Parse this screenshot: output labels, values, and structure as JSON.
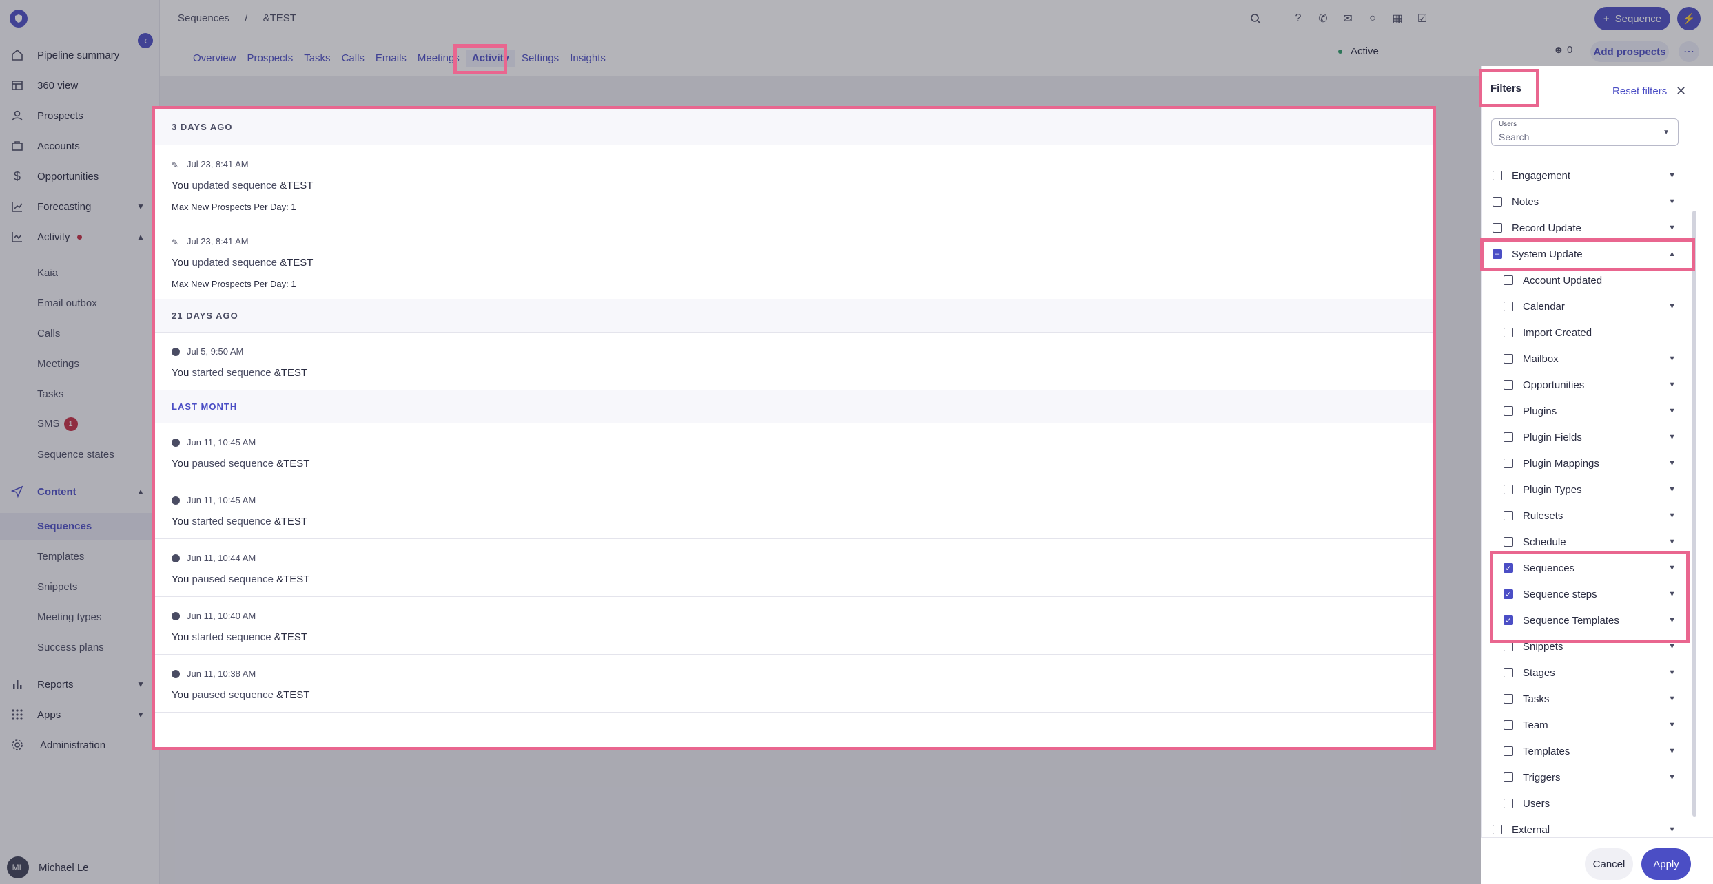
{
  "sidebar": {
    "items": [
      {
        "label": "Pipeline summary",
        "icon": "home-icon"
      },
      {
        "label": "360 view",
        "icon": "table-icon"
      },
      {
        "label": "Prospects",
        "icon": "person-icon"
      },
      {
        "label": "Accounts",
        "icon": "briefcase-icon"
      },
      {
        "label": "Opportunities",
        "icon": "dollar-icon"
      },
      {
        "label": "Forecasting",
        "icon": "chart-icon"
      },
      {
        "label": "Activity",
        "icon": "activity-icon"
      }
    ],
    "activity_sub": [
      "Kaia",
      "Email outbox",
      "Calls",
      "Meetings",
      "Tasks",
      "SMS",
      "Sequence states"
    ],
    "sms_badge": "1",
    "content_label": "Content",
    "content_sub": [
      "Sequences",
      "Templates",
      "Snippets",
      "Meeting types",
      "Success plans"
    ],
    "reports_label": "Reports",
    "apps_label": "Apps",
    "admin_label": "Administration",
    "user_initials": "ML",
    "user_name": "Michael Le"
  },
  "header": {
    "breadcrumb_root": "Sequences",
    "breadcrumb_sep": "/",
    "breadcrumb_current": "&TEST",
    "sequence_button": "Sequence",
    "tabs": [
      "Overview",
      "Prospects",
      "Tasks",
      "Calls",
      "Emails",
      "Meetings",
      "Activity",
      "Settings",
      "Insights"
    ],
    "active_tab": "Activity",
    "status": "Active",
    "people_count": "0",
    "add_prospects": "Add prospects"
  },
  "activity": {
    "groups": [
      {
        "heading": "3 DAYS AGO",
        "entries": [
          {
            "time": "Jul 23, 8:41 AM",
            "actor": "You",
            "action": "updated sequence",
            "target": "&TEST",
            "detail": "Max New Prospects Per Day: 1",
            "icon": "pencil-icon"
          },
          {
            "time": "Jul 23, 8:41 AM",
            "actor": "You",
            "action": "updated sequence",
            "target": "&TEST",
            "detail": "Max New Prospects Per Day: 1",
            "icon": "pencil-icon"
          }
        ]
      },
      {
        "heading": "21 DAYS AGO",
        "entries": [
          {
            "time": "Jul 5, 9:50 AM",
            "actor": "You",
            "action": "started sequence",
            "target": "&TEST",
            "icon": "play-icon"
          }
        ]
      },
      {
        "heading": "LAST MONTH",
        "entries": [
          {
            "time": "Jun 11, 10:45 AM",
            "actor": "You",
            "action": "paused sequence",
            "target": "&TEST",
            "icon": "pause-icon"
          },
          {
            "time": "Jun 11, 10:45 AM",
            "actor": "You",
            "action": "started sequence",
            "target": "&TEST",
            "icon": "play-icon"
          },
          {
            "time": "Jun 11, 10:44 AM",
            "actor": "You",
            "action": "paused sequence",
            "target": "&TEST",
            "icon": "pause-icon"
          },
          {
            "time": "Jun 11, 10:40 AM",
            "actor": "You",
            "action": "started sequence",
            "target": "&TEST",
            "icon": "play-icon"
          },
          {
            "time": "Jun 11, 10:38 AM",
            "actor": "You",
            "action": "paused sequence",
            "target": "&TEST",
            "icon": "pause-icon"
          }
        ]
      }
    ]
  },
  "filters": {
    "title": "Filters",
    "reset": "Reset filters",
    "users_label": "Users",
    "users_placeholder": "Search",
    "items": [
      {
        "label": "Engagement",
        "state": "unchecked",
        "level": 0
      },
      {
        "label": "Notes",
        "state": "unchecked",
        "level": 0
      },
      {
        "label": "Record Update",
        "state": "unchecked",
        "level": 0
      },
      {
        "label": "System Update",
        "state": "partial",
        "level": 0,
        "expanded": true
      },
      {
        "label": "Account Updated",
        "state": "unchecked",
        "level": 1,
        "no_chevron": true
      },
      {
        "label": "Calendar",
        "state": "unchecked",
        "level": 1
      },
      {
        "label": "Import Created",
        "state": "unchecked",
        "level": 1,
        "no_chevron": true
      },
      {
        "label": "Mailbox",
        "state": "unchecked",
        "level": 1
      },
      {
        "label": "Opportunities",
        "state": "unchecked",
        "level": 1
      },
      {
        "label": "Plugins",
        "state": "unchecked",
        "level": 1
      },
      {
        "label": "Plugin Fields",
        "state": "unchecked",
        "level": 1
      },
      {
        "label": "Plugin Mappings",
        "state": "unchecked",
        "level": 1
      },
      {
        "label": "Plugin Types",
        "state": "unchecked",
        "level": 1
      },
      {
        "label": "Rulesets",
        "state": "unchecked",
        "level": 1
      },
      {
        "label": "Schedule",
        "state": "unchecked",
        "level": 1
      },
      {
        "label": "Sequences",
        "state": "checked",
        "level": 1
      },
      {
        "label": "Sequence steps",
        "state": "checked",
        "level": 1
      },
      {
        "label": "Sequence Templates",
        "state": "checked",
        "level": 1
      },
      {
        "label": "Snippets",
        "state": "unchecked",
        "level": 1
      },
      {
        "label": "Stages",
        "state": "unchecked",
        "level": 1
      },
      {
        "label": "Tasks",
        "state": "unchecked",
        "level": 1
      },
      {
        "label": "Team",
        "state": "unchecked",
        "level": 1
      },
      {
        "label": "Templates",
        "state": "unchecked",
        "level": 1
      },
      {
        "label": "Triggers",
        "state": "unchecked",
        "level": 1
      },
      {
        "label": "Users",
        "state": "unchecked",
        "level": 1,
        "no_chevron": true
      },
      {
        "label": "External",
        "state": "unchecked",
        "level": 0
      }
    ],
    "cancel": "Cancel",
    "apply": "Apply"
  },
  "colors": {
    "accent": "#4b4ec5",
    "highlight": "#e9668f",
    "badge": "#c62d43"
  }
}
